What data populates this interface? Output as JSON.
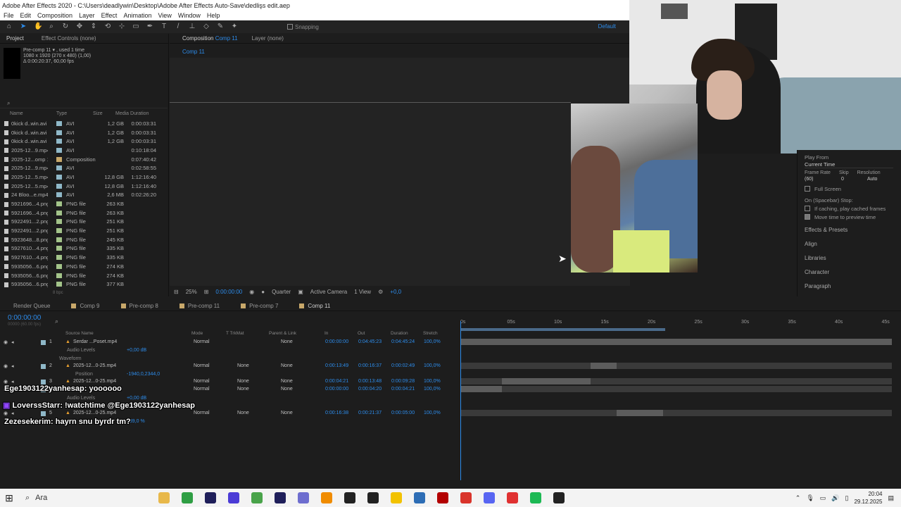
{
  "window": {
    "title": "Adobe After Effects 2020 - C:\\Users\\deadlywin\\Desktop\\Adobe After Effects Auto-Save\\dedlişs edit.aep"
  },
  "menu": [
    "File",
    "Edit",
    "Composition",
    "Layer",
    "Effect",
    "Animation",
    "View",
    "Window",
    "Help"
  ],
  "toolbar": {
    "snapping_label": "Snapping",
    "workspace_label": "Default"
  },
  "project": {
    "tab_project": "Project",
    "tab_effect_controls": "Effect Controls (none)",
    "selected_name": "Pre-comp 11 ▾ , used 1 time",
    "selected_dims": "1080 x 1920  (270 x 480) (1,00)",
    "selected_duration": "Δ 0:00:20:37, 60,00 fps",
    "columns": {
      "name": "Name",
      "type": "Type",
      "size": "Size",
      "duration": "Media Duration"
    },
    "files": [
      {
        "name": "0kick d..win.avi",
        "type": "AVI",
        "size": "1,2 GB",
        "duration": "0:00:03:31",
        "label_color": "#8fb8c8"
      },
      {
        "name": "0kick d..win.avi",
        "type": "AVI",
        "size": "1,2 GB",
        "duration": "0:00:03:31",
        "label_color": "#8fb8c8"
      },
      {
        "name": "0kick d..win.avi",
        "type": "AVI",
        "size": "1,2 GB",
        "duration": "0:00:03:31",
        "label_color": "#8fb8c8"
      },
      {
        "name": "2025-12...9.mp4",
        "type": "AVI",
        "size": "",
        "duration": "0:10:18:04",
        "label_color": "#8fb8c8"
      },
      {
        "name": "2025-12...omp 1",
        "type": "Composition",
        "size": "",
        "duration": "0:07:40:42",
        "label_color": "#c8a86a"
      },
      {
        "name": "2025-12...9.mp4",
        "type": "AVI",
        "size": "",
        "duration": "0:02:58:55",
        "label_color": "#8fb8c8"
      },
      {
        "name": "2025-12...5.mp4",
        "type": "AVI",
        "size": "12,8 GB",
        "duration": "1:12:16:40",
        "label_color": "#8fb8c8"
      },
      {
        "name": "2025-12...5.mp4",
        "type": "AVI",
        "size": "12,8 GB",
        "duration": "1:12:16:40",
        "label_color": "#8fb8c8"
      },
      {
        "name": "24 Bloo...e.mp4",
        "type": "AVI",
        "size": "2,6 MB",
        "duration": "0:02:26:20",
        "label_color": "#8fb8c8"
      },
      {
        "name": "5921696...4.png",
        "type": "PNG file",
        "size": "263 KB",
        "duration": "",
        "label_color": "#a3c48a"
      },
      {
        "name": "5921696...4.png",
        "type": "PNG file",
        "size": "263 KB",
        "duration": "",
        "label_color": "#a3c48a"
      },
      {
        "name": "5922491...2.png",
        "type": "PNG file",
        "size": "251 KB",
        "duration": "",
        "label_color": "#a3c48a"
      },
      {
        "name": "5922491...2.png",
        "type": "PNG file",
        "size": "251 KB",
        "duration": "",
        "label_color": "#a3c48a"
      },
      {
        "name": "5923648...8.png",
        "type": "PNG file",
        "size": "245 KB",
        "duration": "",
        "label_color": "#a3c48a"
      },
      {
        "name": "5927610...4.png",
        "type": "PNG file",
        "size": "335 KB",
        "duration": "",
        "label_color": "#a3c48a"
      },
      {
        "name": "5927610...4.png",
        "type": "PNG file",
        "size": "335 KB",
        "duration": "",
        "label_color": "#a3c48a"
      },
      {
        "name": "5935056...6.png",
        "type": "PNG file",
        "size": "274 KB",
        "duration": "",
        "label_color": "#a3c48a"
      },
      {
        "name": "5935056...6.png",
        "type": "PNG file",
        "size": "274 KB",
        "duration": "",
        "label_color": "#a3c48a"
      },
      {
        "name": "5935056...6.png",
        "type": "PNG file",
        "size": "377 KB",
        "duration": "",
        "label_color": "#a3c48a"
      }
    ],
    "footer_bpc": "8 bpc"
  },
  "composition": {
    "tab_label": "Composition",
    "tab_comp_name": "Comp 11",
    "tab_layer": "Layer (none)",
    "crumb": "Comp 11",
    "zoom": "25%",
    "timecode": "0:00:00:00",
    "resolution": "Quarter",
    "camera": "Active Camera",
    "views": "1 View",
    "exposure": "+0,0"
  },
  "preview": {
    "play_from": "Play From",
    "play_from_value": "Current Time",
    "frame_rate_label": "Frame Rate",
    "skip_label": "Skip",
    "resolution_label": "Resolution",
    "frame_rate_value": "(60)",
    "skip_value": "0",
    "resolution_value": "Auto",
    "full_screen": "Full Screen",
    "on_spacebar": "On (Spacebar) Stop:",
    "if_caching": "If caching, play cached frames",
    "move_time": "Move time to preview time",
    "sections": [
      "Effects & Presets",
      "Align",
      "Libraries",
      "Character",
      "Paragraph"
    ]
  },
  "timeline": {
    "tabs": [
      {
        "label": "Render Queue",
        "color": ""
      },
      {
        "label": "Comp 9",
        "color": "#c8a86a"
      },
      {
        "label": "Pre-comp 8",
        "color": "#c8a86a"
      },
      {
        "label": "Pre-comp 11",
        "color": "#c8a86a"
      },
      {
        "label": "Pre-comp 7",
        "color": "#c8a86a"
      },
      {
        "label": "Comp 11",
        "color": "#c8a86a"
      }
    ],
    "timecode": "0:00:00:00",
    "timecode_sub": "00000 (60.00 fps)",
    "headers": {
      "source": "Source Name",
      "mode": "Mode",
      "trkmat": "T  TrkMat",
      "parent": "Parent & Link",
      "in": "In",
      "out": "Out",
      "duration": "Duration",
      "stretch": "Stretch"
    },
    "ruler": [
      "0s",
      "05s",
      "10s",
      "15s",
      "20s",
      "25s",
      "30s",
      "35s",
      "40s",
      "45s"
    ],
    "layers": [
      {
        "num": "1",
        "name": "Serdar ...Poset.mp4",
        "mode": "Normal",
        "trkmat": "",
        "parent": "None",
        "in": "0:00:00:00",
        "out": "0:04:45:23",
        "duration": "0:04:45:24",
        "stretch": "100,0%"
      },
      {
        "num": "2",
        "name": "2025-12...0-25.mp4",
        "mode": "Normal",
        "trkmat": "None",
        "parent": "None",
        "in": "0:00:13:49",
        "out": "0:00:16:37",
        "duration": "0:00:02:49",
        "stretch": "100,0%"
      },
      {
        "num": "3",
        "name": "2025-12...0-25.mp4",
        "mode": "Normal",
        "trkmat": "None",
        "parent": "None",
        "in": "0:00:04:21",
        "out": "0:00:13:48",
        "duration": "0:00:09:28",
        "stretch": "100,0%"
      },
      {
        "num": "4",
        "name": "",
        "mode": "Normal",
        "trkmat": "None",
        "parent": "None",
        "in": "0:00:00:00",
        "out": "0:00:04:20",
        "duration": "0:00:04:21",
        "stretch": "100,0%"
      },
      {
        "num": "5",
        "name": "2025-12...0-25.mp4",
        "mode": "Normal",
        "trkmat": "None",
        "parent": "None",
        "in": "0:00:16:38",
        "out": "0:00:21:37",
        "duration": "0:00:05:00",
        "stretch": "100,0%"
      }
    ],
    "sub_audio_levels": "Audio Levels",
    "sub_audio_value": "+0,00 dB",
    "sub_waveform": "Waveform",
    "sub_position": "Position",
    "sub_position_value": "-1940,0,2344,0",
    "scale_value": "139,0 %"
  },
  "chat": [
    {
      "user": "Ege1903122yanhesap",
      "message": ": yoooooo"
    },
    {
      "user": "LoverssStarr",
      "message": ": !watchtime @Ege1903122yanhesap"
    },
    {
      "user": "Zezesekerim",
      "message": ": hayrn snu byrdr tm?"
    }
  ],
  "taskbar": {
    "search_placeholder": "Ara",
    "time": "20:04",
    "date": "29.12.2025",
    "apps": [
      {
        "icon": "file-explorer-icon",
        "color": "#e8b84a"
      },
      {
        "icon": "chrome-icon",
        "color": "#2f9e44"
      },
      {
        "icon": "after-effects-icon",
        "color": "#1f1f5a"
      },
      {
        "icon": "brave-vpn-icon",
        "color": "#4b3bd6"
      },
      {
        "icon": "game-icon",
        "color": "#49a34a"
      },
      {
        "icon": "media-encoder-icon",
        "color": "#1f1f5a"
      },
      {
        "icon": "browser-icon",
        "color": "#6e6ecf"
      },
      {
        "icon": "vlc-icon",
        "color": "#f08c00"
      },
      {
        "icon": "capcut-icon",
        "color": "#222222"
      },
      {
        "icon": "media-icon",
        "color": "#222222"
      },
      {
        "icon": "maps-icon",
        "color": "#f2c200"
      },
      {
        "icon": "photoshop-icon",
        "color": "#2d6db5"
      },
      {
        "icon": "premiere-icon",
        "color": "#b30000"
      },
      {
        "icon": "close-app-icon",
        "color": "#d9342b"
      },
      {
        "icon": "discord-icon",
        "color": "#5865f2"
      },
      {
        "icon": "red-app-icon",
        "color": "#e03131"
      },
      {
        "icon": "spotify-icon",
        "color": "#1db954"
      },
      {
        "icon": "obs-icon",
        "color": "#222222"
      }
    ]
  }
}
